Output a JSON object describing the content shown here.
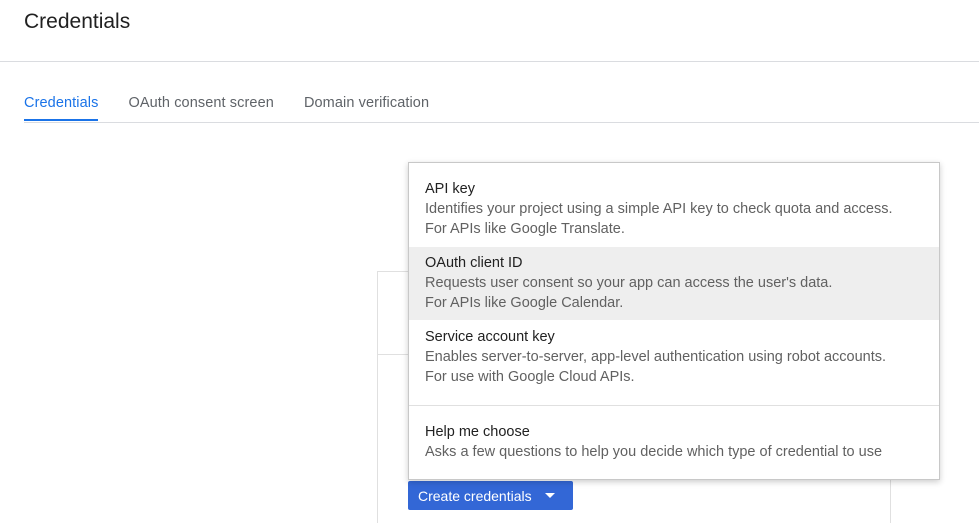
{
  "page": {
    "title": "Credentials"
  },
  "tabs": [
    {
      "label": "Credentials",
      "active": true
    },
    {
      "label": "OAuth consent screen",
      "active": false
    },
    {
      "label": "Domain verification",
      "active": false
    }
  ],
  "create_button": {
    "label": "Create credentials",
    "icon": "caret-down-icon"
  },
  "menu": {
    "items": [
      {
        "title": "API key",
        "description": "Identifies your project using a simple API key to check quota and access.",
        "note": "For APIs like Google Translate."
      },
      {
        "title": "OAuth client ID",
        "description": "Requests user consent so your app can access the user's data.",
        "note": "For APIs like Google Calendar.",
        "highlighted": true
      },
      {
        "title": "Service account key",
        "description": "Enables server-to-server, app-level authentication using robot accounts.",
        "note": "For use with Google Cloud APIs."
      },
      {
        "title": "Help me choose",
        "description": "Asks a few questions to help you decide which type of credential to use"
      }
    ]
  },
  "colors": {
    "accent": "#1a73e8",
    "button": "#3367d6",
    "hover": "#eeeeee"
  }
}
